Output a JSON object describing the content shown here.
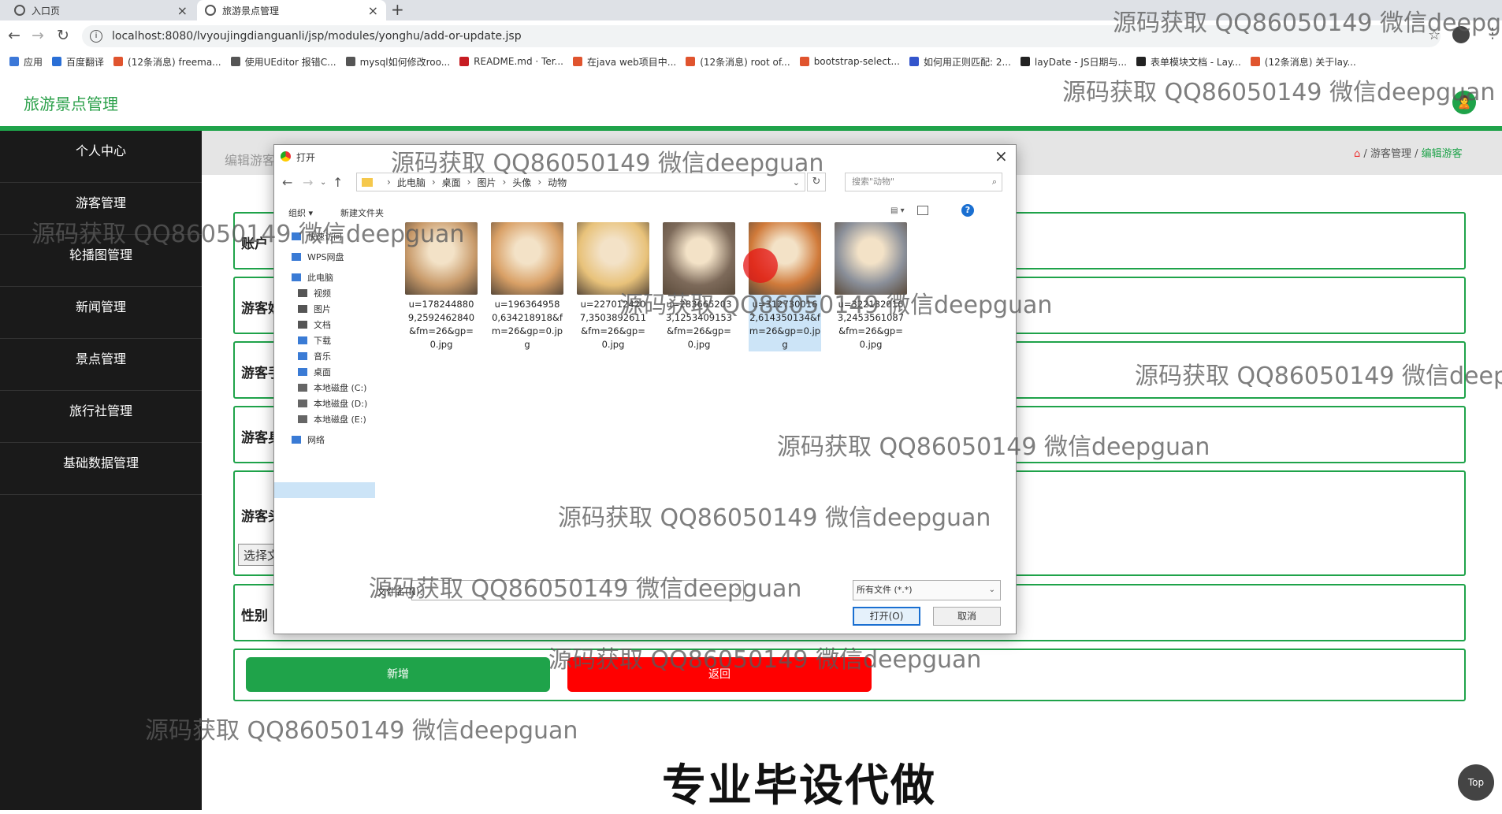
{
  "browser": {
    "tabs": [
      {
        "label": "入口页",
        "close": "×"
      },
      {
        "label": "旅游景点管理",
        "close": "×"
      }
    ],
    "new_tab": "+",
    "url": "localhost:8080/lvyoujingdianguanli/jsp/modules/yonghu/add-or-update.jsp",
    "bookmarks": [
      {
        "label": "应用",
        "color": "#3c78d8"
      },
      {
        "label": "百度翻译",
        "color": "#2a6fd6"
      },
      {
        "label": "(12条消息) freema...",
        "color": "#e0542e"
      },
      {
        "label": "使用UEditor 报错C...",
        "color": "#555555"
      },
      {
        "label": "mysql如何修改roo...",
        "color": "#555555"
      },
      {
        "label": "README.md · Ter...",
        "color": "#c71d23"
      },
      {
        "label": "在java web项目中...",
        "color": "#e0542e"
      },
      {
        "label": "(12条消息) root of...",
        "color": "#e0542e"
      },
      {
        "label": "bootstrap-select...",
        "color": "#e0542e"
      },
      {
        "label": "如何用正则匹配: 2...",
        "color": "#3355cc"
      },
      {
        "label": "layDate - JS日期与...",
        "color": "#222222"
      },
      {
        "label": "表单模块文档 - Lay...",
        "color": "#222222"
      },
      {
        "label": "(12条消息) 关于lay...",
        "color": "#e0542e"
      }
    ]
  },
  "app": {
    "title": "旅游景点管理",
    "avatar_glyph": "🙎",
    "sidebar": [
      "个人中心",
      "游客管理",
      "轮播图管理",
      "新闻管理",
      "景点管理",
      "旅行社管理",
      "基础数据管理"
    ],
    "breadcrumb_left": "编辑游客",
    "breadcrumb_right": {
      "home": "⌂",
      "sep": "/",
      "parent": "游客管理",
      "current": "编辑游客"
    },
    "form_labels": [
      "账户",
      "游客姓名",
      "游客手机号",
      "游客身份证号",
      "游客头像",
      "性别"
    ],
    "choose_button": "选择文件",
    "add_button": "新增",
    "back_button": "返回",
    "top_button": "Top",
    "caption": "专业毕设代做"
  },
  "dialog": {
    "title": "打开",
    "close": "×",
    "path": [
      "此电脑",
      "桌面",
      "图片",
      "头像",
      "动物"
    ],
    "search_placeholder": "搜索\"动物\"",
    "organize": "组织 ▾",
    "new_folder": "新建文件夹",
    "nav": [
      {
        "label": "快速访问",
        "color": "#3a7bd5"
      },
      {
        "label": "WPS网盘",
        "color": "#3a7bd5"
      },
      {
        "label": "此电脑",
        "color": "#3a7bd5"
      },
      {
        "label": "视频",
        "color": "#555555"
      },
      {
        "label": "图片",
        "color": "#555555"
      },
      {
        "label": "文档",
        "color": "#555555"
      },
      {
        "label": "下载",
        "color": "#3a7bd5"
      },
      {
        "label": "音乐",
        "color": "#3a7bd5"
      },
      {
        "label": "桌面",
        "color": "#3a7bd5"
      },
      {
        "label": "本地磁盘 (C:)",
        "color": "#666666"
      },
      {
        "label": "本地磁盘 (D:)",
        "color": "#666666"
      },
      {
        "label": "本地磁盘 (E:)",
        "color": "#666666"
      },
      {
        "label": "网络",
        "color": "#3a7bd5"
      }
    ],
    "files": [
      {
        "name": "u=1782448809,2592462840&fm=26&gp=0.jpg",
        "thumb": "cat-bandana",
        "color": "#c89a6a"
      },
      {
        "name": "u=1963649580,634218918&fm=26&gp=0.jpg",
        "thumb": "shiba-puppy",
        "color": "#d9a066"
      },
      {
        "name": "u=2270124207,3503892611&fm=26&gp=0.jpg",
        "thumb": "golden-puppy",
        "color": "#e8c27a"
      },
      {
        "name": "u=2836652033,1253409153&fm=26&gp=0.jpg",
        "thumb": "cat-gray",
        "color": "#7d6a5a"
      },
      {
        "name": "u=3127300162,614350134&fm=26&gp=0.jpg",
        "thumb": "shiba-smile",
        "color": "#d07a3a"
      },
      {
        "name": "u=3221320163,2453561087&fm=26&gp=0.jpg",
        "thumb": "husky",
        "color": "#8a8f99"
      }
    ],
    "filename_label": "文件名(N):",
    "filetype": "所有文件 (*.*)",
    "open_button": "打开(O)",
    "cancel_button": "取消"
  },
  "watermark": "源码获取 QQ86050149 微信deepguan",
  "colors": {
    "accent": "#1fa34a",
    "danger": "#ff0000",
    "sidebar": "#1a1a1a"
  }
}
